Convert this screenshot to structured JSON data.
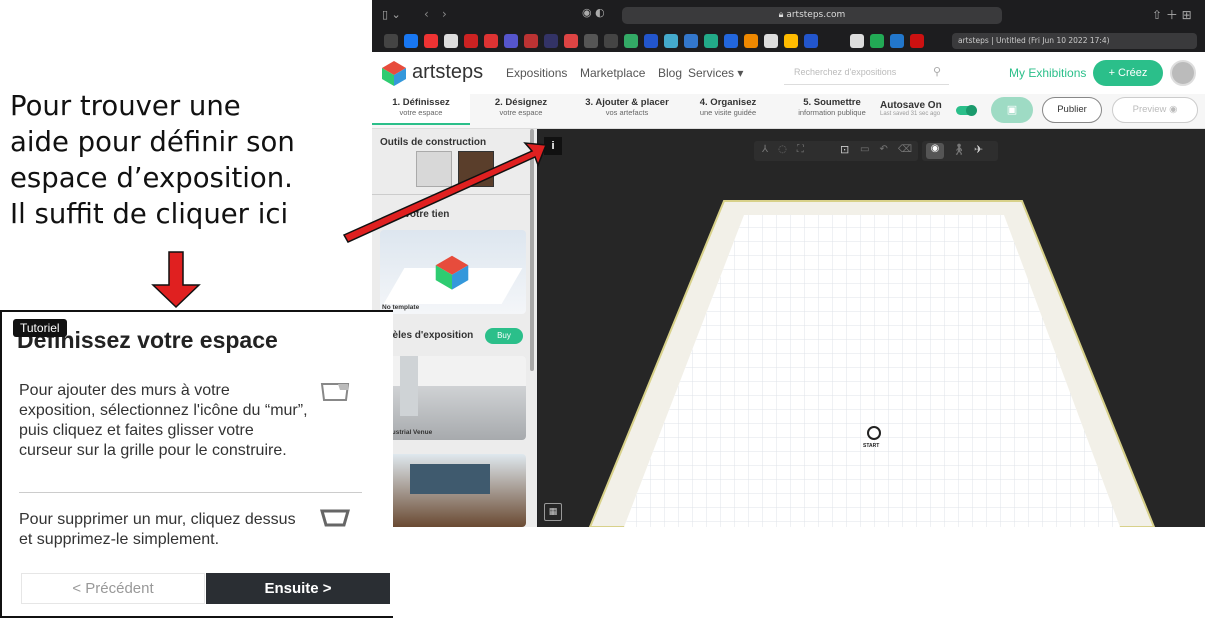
{
  "annotation": {
    "lines": [
      "Pour trouver une",
      "aide pour définir son",
      "espace d’exposition.",
      "Il suffit de cliquer ici"
    ],
    "arrow_color": "#e02020"
  },
  "browser": {
    "url": "artsteps.com",
    "tab_title": "artsteps | Untitled (Fri Jun 10 2022 17:4)"
  },
  "nav": {
    "logo_text": "artsteps",
    "links": [
      "Expositions",
      "Marketplace",
      "Blog",
      "Services"
    ],
    "search_placeholder": "Recherchez d'expositions",
    "my_exhibitions": "My Exhibitions",
    "create_label": "+ Créez",
    "accent": "#2bbf8a"
  },
  "steps": [
    {
      "title": "1. Définissez",
      "sub": "votre espace"
    },
    {
      "title": "2. Désignez",
      "sub": "votre espace"
    },
    {
      "title": "3. Ajouter & placer",
      "sub": "vos artefacts"
    },
    {
      "title": "4. Organisez",
      "sub": "une visite guidée"
    },
    {
      "title": "5. Soumettre",
      "sub": "information publique"
    }
  ],
  "autosave": {
    "label": "Autosave On",
    "sub": "Last saved 31 sec ago"
  },
  "actions": {
    "publish": "Publier",
    "preview": "Preview"
  },
  "left_panel": {
    "section_tools": "Outils de construction",
    "section_own": "Votre tien",
    "no_template": "No template",
    "section_models": "Modèles d'exposition",
    "buy": "Buy",
    "industrial": "Industrial Venue"
  },
  "viewport": {
    "info_icon": "i",
    "start_label": "START"
  },
  "tutorial": {
    "badge": "Tutoriel",
    "title": "Définissez votre espace",
    "p1": "Pour ajouter des murs à votre exposition, sélectionnez l'icône du “mur”, puis cliquez et faites glisser votre curseur sur la grille pour le construire.",
    "p2": "Pour supprimer un mur, cliquez dessus et supprimez-le simplement.",
    "prev": "< Précédent",
    "next": "Ensuite >"
  }
}
